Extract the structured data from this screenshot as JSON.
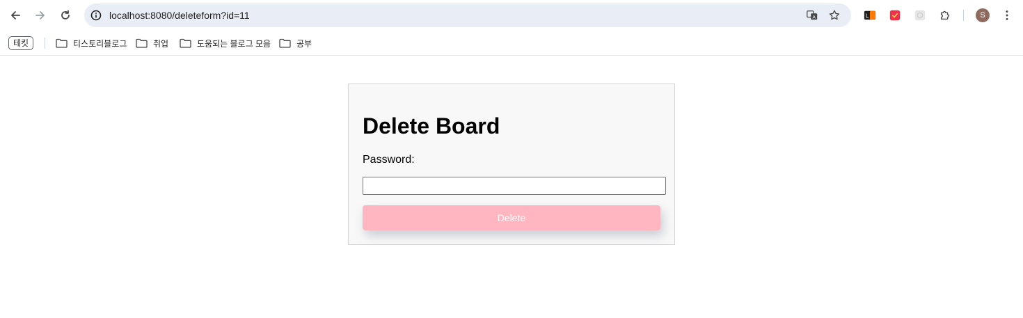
{
  "browser": {
    "url": "localhost:8080/deleteform?id=11",
    "nav": {
      "back_icon": "arrow-left-icon",
      "forward_icon": "arrow-right-icon",
      "reload_icon": "reload-icon"
    },
    "omnibox_icons": [
      "translate-icon",
      "star-icon"
    ],
    "extensions": [
      "lh-extension-icon",
      "red-extension-icon",
      "grey-extension-icon",
      "puzzle-icon"
    ],
    "profile_initial": "S",
    "profile_color": "#8e6b5e"
  },
  "bookmarks": {
    "chip": "테킷",
    "folders": [
      {
        "label": "티스토리블로그"
      },
      {
        "label": "취업"
      },
      {
        "label": "도움되는 블로그 모음"
      },
      {
        "label": "공부"
      }
    ]
  },
  "page": {
    "title": "Delete Board",
    "password_label": "Password:",
    "password_value": "",
    "delete_label": "Delete",
    "colors": {
      "delete_button": "#ffb6c1",
      "card_bg": "#f8f8f8"
    }
  }
}
